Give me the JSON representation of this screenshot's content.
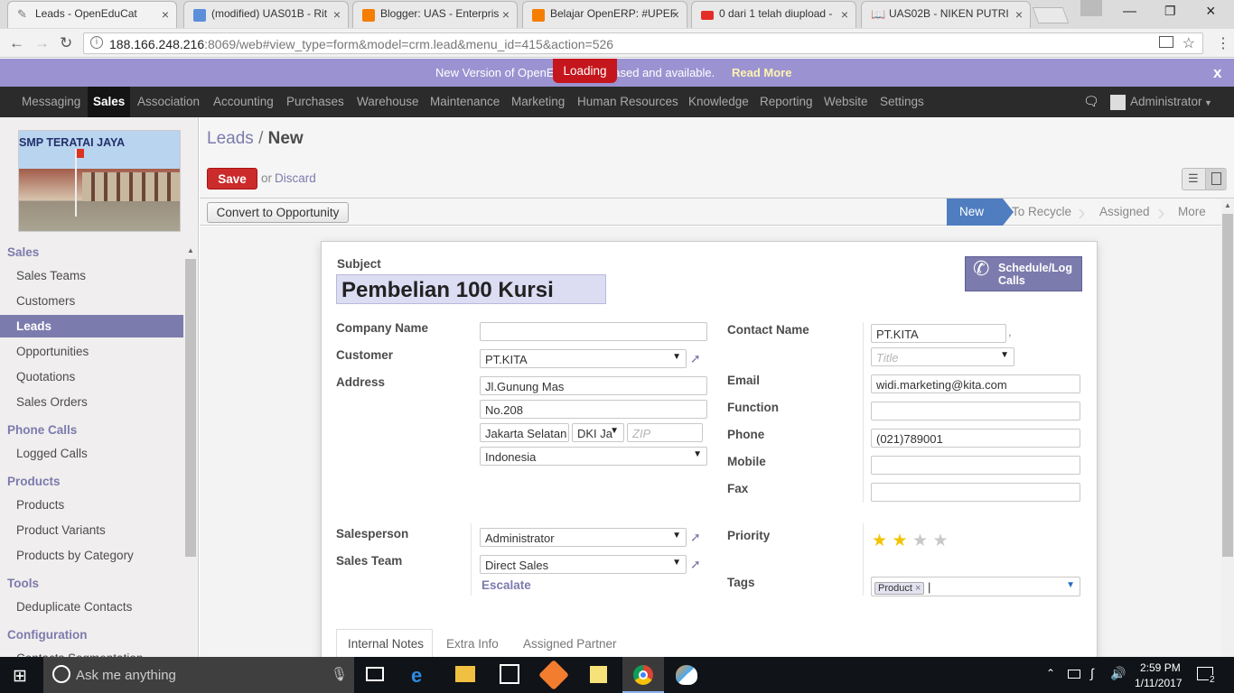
{
  "browser": {
    "tabs": [
      {
        "title": "Leads - OpenEduCat",
        "active": true
      },
      {
        "title": "(modified) UAS01B - Rit",
        "active": false
      },
      {
        "title": "Blogger: UAS - Enterpris",
        "active": false
      },
      {
        "title": "Belajar OpenERP: #UPEF",
        "active": false
      },
      {
        "title": "0 dari 1 telah diupload -",
        "active": false
      },
      {
        "title": "UAS02B - NIKEN PUTRI",
        "active": false
      }
    ],
    "url_host": "188.166.248.216",
    "url_rest": ":8069/web#view_type=form&model=crm.lead&menu_id=415&action=526"
  },
  "banner": {
    "text_left": "New Version of OpenE",
    "loading": "Loading",
    "text_right": "eased and available.",
    "read_more": "Read More",
    "close": "x"
  },
  "topnav": {
    "items": [
      "Messaging",
      "Sales",
      "Association",
      "Accounting",
      "Purchases",
      "Warehouse",
      "Maintenance",
      "Marketing",
      "Human Resources",
      "Knowledge",
      "Reporting",
      "Website",
      "Settings"
    ],
    "user": "Administrator"
  },
  "sidebar": {
    "logo_text": "SMP TERATAI JAYA",
    "sections": [
      {
        "title": "Sales",
        "items": [
          "Sales Teams",
          "Customers",
          "Leads",
          "Opportunities",
          "Quotations",
          "Sales Orders"
        ]
      },
      {
        "title": "Phone Calls",
        "items": [
          "Logged Calls"
        ]
      },
      {
        "title": "Products",
        "items": [
          "Products",
          "Product Variants",
          "Products by Category"
        ]
      },
      {
        "title": "Tools",
        "items": [
          "Deduplicate Contacts"
        ]
      },
      {
        "title": "Configuration",
        "items": [
          "Contacts Segmentation"
        ]
      }
    ],
    "selected": "Leads"
  },
  "breadcrumb": {
    "parent": "Leads",
    "separator": "/",
    "current": "New"
  },
  "actions": {
    "save": "Save",
    "or": "or",
    "discard": "Discard",
    "convert": "Convert to Opportunity"
  },
  "stages": [
    "New",
    "To Recycle",
    "Assigned",
    "More"
  ],
  "form": {
    "subject_label": "Subject",
    "subject_value": "Pembelian 100 Kursi",
    "schedule_button": "Schedule/Log Calls",
    "company_name_label": "Company Name",
    "company_name_value": "",
    "customer_label": "Customer",
    "customer_value": "PT.KITA",
    "address_label": "Address",
    "street": "Jl.Gunung Mas",
    "street2": "No.208",
    "city": "Jakarta Selatan",
    "state": "DKI Ja",
    "zip_placeholder": "ZIP",
    "country": "Indonesia",
    "contact_name_label": "Contact Name",
    "contact_name_value": "PT.KITA",
    "contact_comma": ",",
    "title_placeholder": "Title",
    "email_label": "Email",
    "email_value": "widi.marketing@kita.com",
    "function_label": "Function",
    "function_value": "",
    "phone_label": "Phone",
    "phone_value": "(021)789001",
    "mobile_label": "Mobile",
    "mobile_value": "",
    "fax_label": "Fax",
    "fax_value": "",
    "salesperson_label": "Salesperson",
    "salesperson_value": "Administrator",
    "sales_team_label": "Sales Team",
    "sales_team_value": "Direct Sales",
    "escalate": "Escalate",
    "priority_label": "Priority",
    "priority_value": 2,
    "priority_max": 5,
    "tags_label": "Tags",
    "tag": "Product",
    "notebook_tabs": [
      "Internal Notes",
      "Extra Info",
      "Assigned Partner"
    ]
  },
  "taskbar": {
    "search_placeholder": "Ask me anything",
    "time": "2:59 PM",
    "date": "1/11/2017",
    "notifications": "2"
  },
  "colors": {
    "accent": "#7c7bad",
    "save": "#cc2b2b",
    "stage_active": "#4f7dc0",
    "topnav": "#2b2b2b",
    "banner": "#9b93d1"
  }
}
